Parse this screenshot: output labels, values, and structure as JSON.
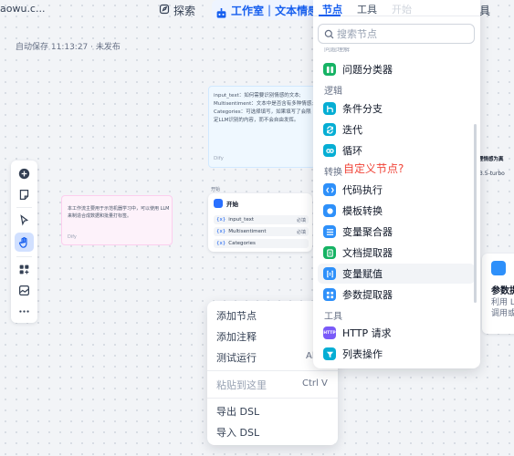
{
  "topbar": {
    "domain": "aowu.c...",
    "explore": "探索",
    "workspace": "工作室",
    "app_title": "文本情感",
    "right_tool": "具"
  },
  "autosave": "自动保存 11:13:27 · 未发布",
  "notes": {
    "pink_text": "本工作流主要用于示范机器学习中，可以使用 LLM 来制造合成数据和批量打标签。",
    "pink_author": "Dify",
    "blue_text": "input_text：如何需要识别情感的文本; Multisentiment：文本中是否含有多种情感; Categories：可选择填写，如果填写了会限定LLM识别的内容，而不会自由发挥。",
    "blue_author": "Dify"
  },
  "start_node": {
    "tag": "开始",
    "name": "开始",
    "vars": [
      {
        "name": "input_text",
        "req": "必填"
      },
      {
        "name": "Multisentiment",
        "req": "必填"
      },
      {
        "name": "Categories",
        "req": ""
      }
    ]
  },
  "right_nodes": {
    "label": "理情感为真",
    "model": "3.5-turbo",
    "param_title": "参数提",
    "param_desc": "利用 L 出结构 调用或"
  },
  "context_menu": {
    "items": [
      {
        "label": "添加节点",
        "shortcut": ""
      },
      {
        "label": "添加注释",
        "shortcut": ""
      },
      {
        "label": "测试运行",
        "shortcut": "Al"
      },
      {
        "label": "粘贴到这里",
        "shortcut": "Ctrl V"
      },
      {
        "label": "导出 DSL",
        "shortcut": ""
      },
      {
        "label": "导入 DSL",
        "shortcut": ""
      }
    ]
  },
  "picker": {
    "tabs": [
      "节点",
      "工具",
      "开始"
    ],
    "search_placeholder": "搜索节点",
    "cut_category": "问题理解",
    "categories": {
      "logic": "逻辑",
      "transform": "转换",
      "tools": "工具"
    },
    "items": [
      {
        "label": "问题分类器",
        "icon": "classifier-icon",
        "color": "#16b364"
      },
      {
        "label": "条件分支",
        "icon": "branch-icon",
        "color": "#06aed4"
      },
      {
        "label": "迭代",
        "icon": "iteration-icon",
        "color": "#06aed4"
      },
      {
        "label": "循环",
        "icon": "loop-icon",
        "color": "#06aed4"
      },
      {
        "label": "代码执行",
        "icon": "code-icon",
        "color": "#2e90fa"
      },
      {
        "label": "模板转换",
        "icon": "template-icon",
        "color": "#2e90fa"
      },
      {
        "label": "变量聚合器",
        "icon": "aggregator-icon",
        "color": "#2e90fa"
      },
      {
        "label": "文档提取器",
        "icon": "doc-extractor-icon",
        "color": "#16b364"
      },
      {
        "label": "变量赋值",
        "icon": "assigner-icon",
        "color": "#2e90fa"
      },
      {
        "label": "参数提取器",
        "icon": "param-extractor-icon",
        "color": "#2e90fa"
      },
      {
        "label": "HTTP 请求",
        "icon": "http-icon",
        "color": "#7a5af8"
      },
      {
        "label": "列表操作",
        "icon": "list-icon",
        "color": "#06aed4"
      }
    ],
    "tooltip": "自定义节点?"
  }
}
